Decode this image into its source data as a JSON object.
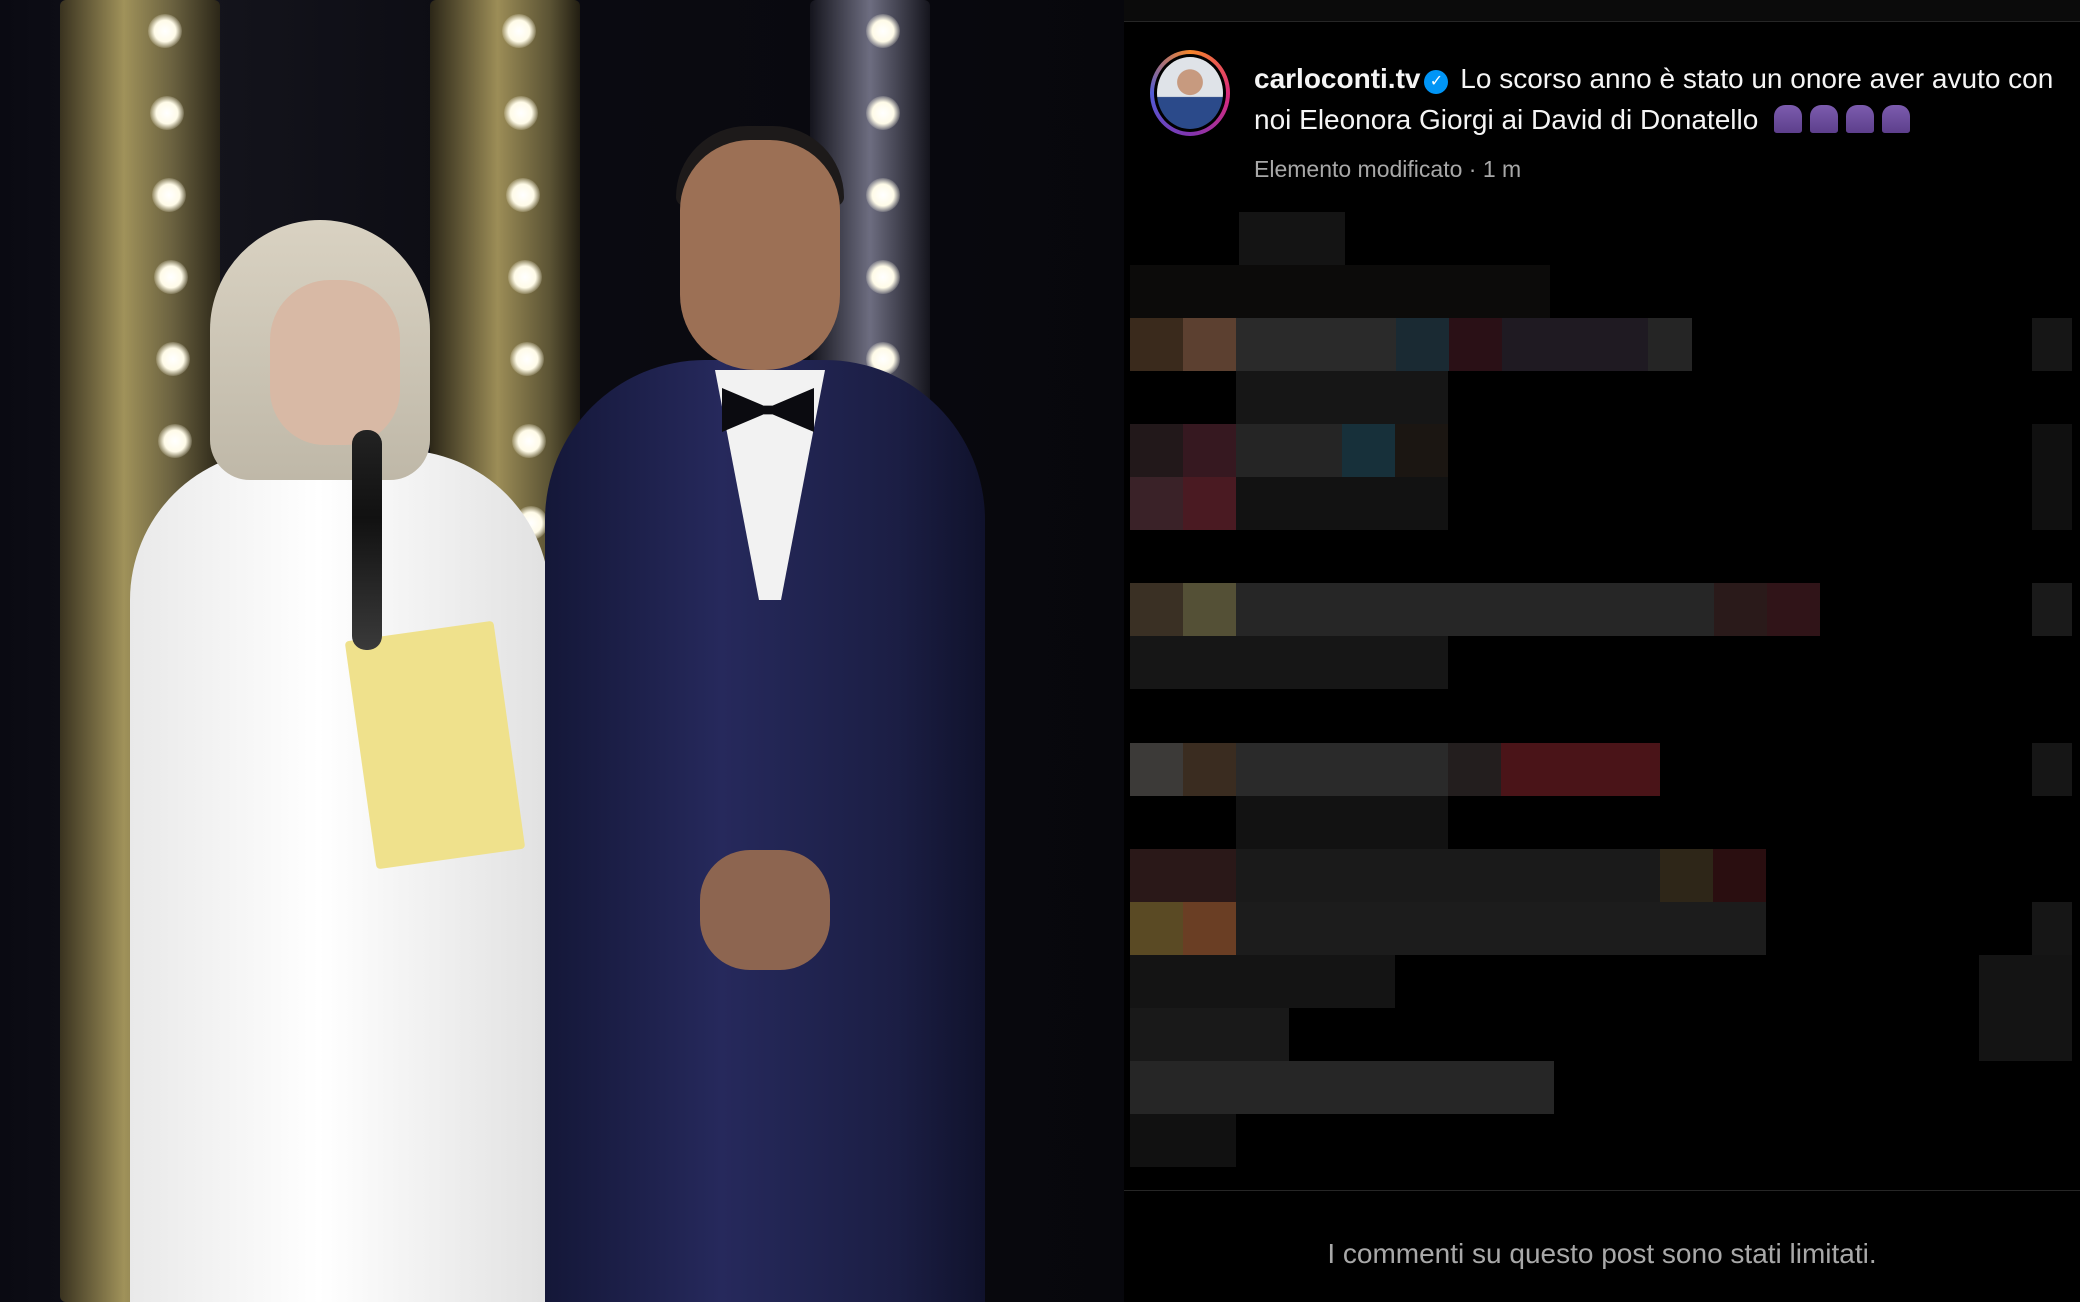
{
  "post": {
    "username": "carloconti.tv",
    "caption": "Lo scorso anno è stato un onore aver avuto con noi Eleonora Giorgi ai David di Donatello",
    "meta": "Elemento modificato · 1 m",
    "verified_icon": "verified-badge-icon",
    "emojis": [
      "folded-hands",
      "folded-hands",
      "folded-hands",
      "folded-hands"
    ]
  },
  "comments_notice": "I commenti su questo post sono stati limitati.",
  "colors": {
    "background": "#000000",
    "text": "#f5f5f5",
    "secondary_text": "#a8a8a8",
    "verified": "#0095f6"
  }
}
